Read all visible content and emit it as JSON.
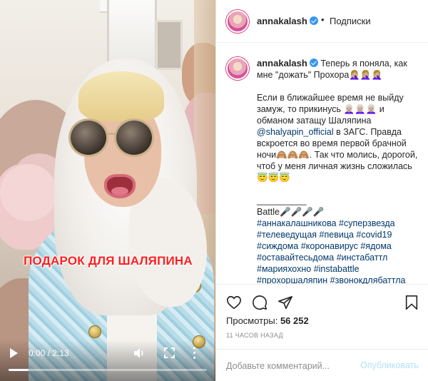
{
  "video": {
    "overlay_caption": "ПОДАРОК ДЛЯ ШАЛЯПИНА",
    "current_time": "0:00",
    "duration": "2:13",
    "time_display": "0:00 / 2:13",
    "progress_fraction": 0.1
  },
  "post": {
    "username": "annakalash",
    "separator": "•",
    "follow_label": "Подписки",
    "caption": "Теперь я поняла, как мне \"дожать\" Прохора🤦🏼‍♀️🤦🏼‍♀️🤦🏼‍♀️\n\nЕсли в ближайшее время не выйду замуж, то прикинусь 👩🏼‍🦳👩🏼‍🦳👩🏼‍🦳 и обманом затащу Шаляпина ",
    "caption_mention": "@shalyapin_official",
    "caption_after_mention": " в ЗАГС. Правда вскроется во время первой брачной ночи🙈🙈🙈. Так что молись, дорогой, чтоб у меня личная жизнь сложилась😇😇😇\n\n__________\nBattle🎤🎤🎤🎤",
    "hashtags": "#аннакалашникова #суперзвезда #телеведущая #певица #covid19 #сиждома #коронавирус #ядома #оставайтесьдома #инстабаттл #марияхохно #instabattle #прохоршаляпин #звонокдлябаттла",
    "views_label": "Просмотры:",
    "views_count": "56 252",
    "time_ago": "11 часов назад",
    "comment_placeholder": "Добавьте комментарий...",
    "publish_label": "Опубликовать"
  },
  "colors": {
    "overlay_text": "#ff1f1f",
    "verified_badge": "#3897f0",
    "link": "#00376b",
    "publish_disabled": "#b2dffc"
  },
  "icons": [
    "play-icon",
    "volume-icon",
    "fullscreen-icon",
    "more-vertical-icon",
    "verified-icon",
    "heart-icon",
    "comment-icon",
    "share-icon",
    "bookmark-icon"
  ]
}
